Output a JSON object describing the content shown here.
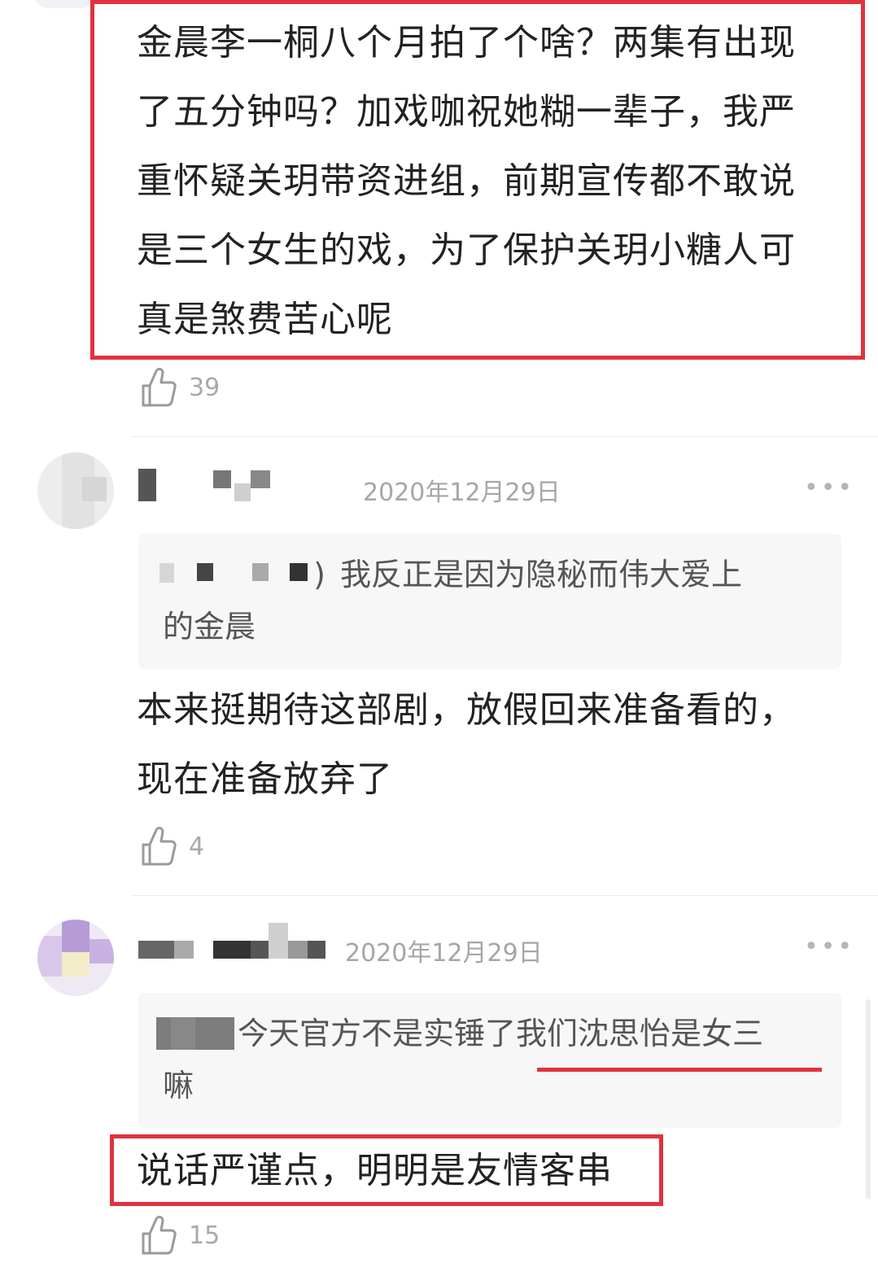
{
  "comments": [
    {
      "text": "金晨李一桐八个月拍了个啥？两集有出现了五分钟吗？加戏咖祝她糊一辈子，我严重怀疑关玥带资进组，前期宣传都不敢说是三个女生的戏，为了保护关玥小糖人可真是煞费苦心呢",
      "lines": [
        "金晨李一桐八个月拍了个啥？两集有出现",
        "了五分钟吗？加戏咖祝她糊一辈子，我严",
        "重怀疑关玥带资进组，前期宣传都不敢说",
        "是三个女生的戏，为了保护关玥小糖人可",
        "真是煞费苦心呢"
      ],
      "likes": "39"
    },
    {
      "date": "2020年12月29日",
      "quote": {
        "suffix": ")",
        "lines": [
          "我反正是因为隐秘而伟大爱上",
          "的金晨"
        ]
      },
      "lines": [
        "本来挺期待这部剧，放假回来准备看的，",
        "现在准备放弃了"
      ],
      "likes": "4"
    },
    {
      "date": "2020年12月29日",
      "quote": {
        "lines": [
          "今天官方不是实锤了我们沈思怡是女三",
          "嘛"
        ]
      },
      "lines": [
        "说话严谨点，明明是友情客串"
      ],
      "likes": "15"
    }
  ],
  "more_icon": "more-dots-icon",
  "like_icon": "thumbs-up-icon",
  "highlight_color": "#e1323f"
}
